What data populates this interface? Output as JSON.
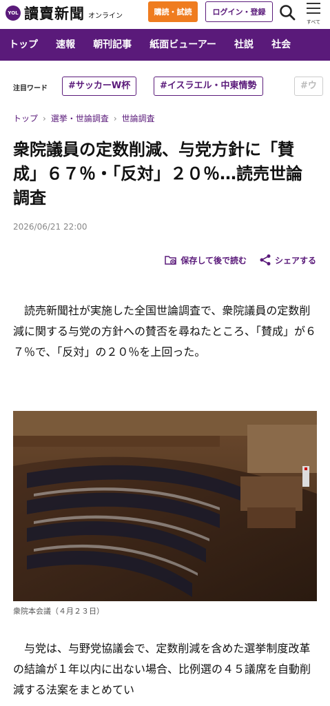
{
  "header": {
    "logo_badge": "YOL",
    "logo_title": "讀賣新聞",
    "logo_sub": "オンライン",
    "subscribe_label": "購読・試読",
    "login_label": "ログイン・登録",
    "menu_label": "すべて"
  },
  "nav": {
    "items": [
      "トップ",
      "速報",
      "朝刊記事",
      "紙面ビューアー",
      "社説",
      "社会"
    ]
  },
  "keywords": {
    "label": "注目ワード",
    "tags": [
      "#サッカーW杯",
      "#イスラエル・中東情勢",
      "#ウ"
    ]
  },
  "breadcrumb": [
    "トップ",
    "選挙・世論調査",
    "世論調査"
  ],
  "article": {
    "title": "衆院議員の定数削減、与党方針に「賛成」６７％・「反対」２０％…読売世論調査",
    "date": "2026/06/21 22:00",
    "save_label": "保存して後で読む",
    "share_label": "シェアする",
    "lead": "読売新聞社が実施した全国世論調査で、衆院議員の定数削減に関する与党の方針への賛否を尋ねたところ、「賛成」が６７％で、「反対」の２０％を上回った。",
    "photo_caption": "衆院本会議（４月２３日）",
    "para2": "与党は、与野党協議会で、定数削減を含めた選挙制度改革の結論が１年以内に出ない場合、比例選の４５議席を自動削減する法案をまとめてい"
  },
  "colors": {
    "brand": "#5a1a7a",
    "subscribe": "#ef7c1f"
  }
}
